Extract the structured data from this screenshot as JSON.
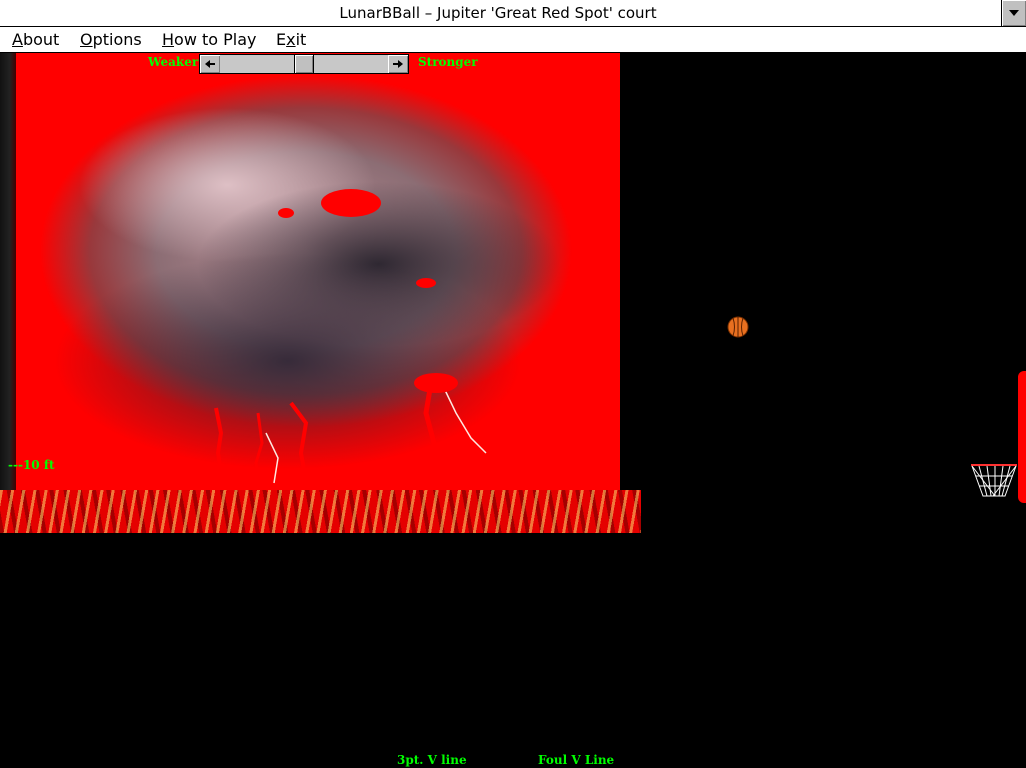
{
  "window": {
    "title": "LunarBBall – Jupiter 'Great Red Spot' court"
  },
  "menu": {
    "items": [
      {
        "label": "About",
        "underline": "A",
        "rest": "bout"
      },
      {
        "label": "Options",
        "underline": "O",
        "rest": "ptions"
      },
      {
        "label": "How to Play",
        "underline": "H",
        "rest": "ow to Play"
      },
      {
        "label": "Exit",
        "pre": "E",
        "underline": "x",
        "rest": "it"
      }
    ]
  },
  "power": {
    "weaker_label": "Weaker",
    "stronger_label": "Stronger",
    "level": 0.5
  },
  "court": {
    "height_marker": "---10 ft",
    "three_point_line": "3pt. V line",
    "foul_line": "Foul V Line"
  },
  "colors": {
    "label_green": "#00ff00",
    "backboard_red": "#ff0000",
    "ball_orange": "#e87020"
  },
  "icons": {
    "scroll": "scroll-down-icon",
    "slider_left": "arrow-left-icon",
    "slider_right": "arrow-right-icon"
  }
}
